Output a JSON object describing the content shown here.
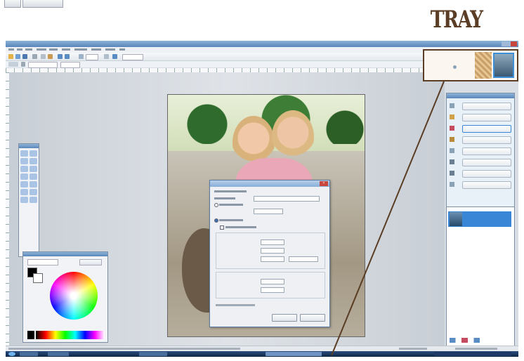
{
  "label": {
    "tray": "TRAY"
  },
  "app": {
    "window_title": ""
  },
  "colors": {
    "accent": "#5a3d24",
    "highlight": "#3a86d6"
  },
  "icons": [
    "tray-thumbnail-icon",
    "close-icon",
    "wheel-icon"
  ]
}
